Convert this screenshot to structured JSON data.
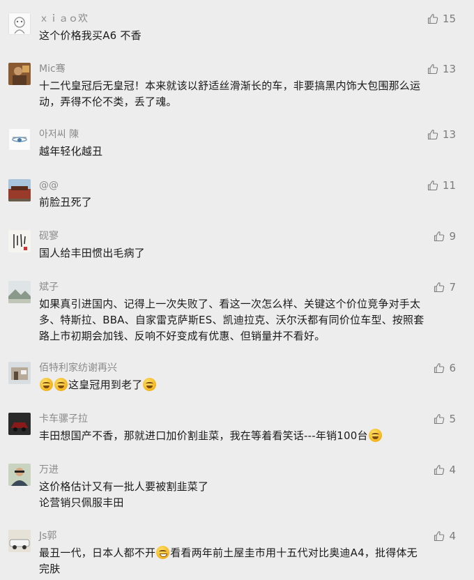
{
  "comments": [
    {
      "nick": "ｘｉａｏ欢",
      "likes": "15",
      "avatar_icon": "robot-avatar-icon",
      "lines": [
        {
          "text": "这个价格我买A6 不香"
        }
      ]
    },
    {
      "nick": "Mic骞",
      "likes": "13",
      "avatar_icon": "photo-avatar-icon",
      "lines": [
        {
          "text": "十二代皇冠后无皇冠！本来就该以舒适丝滑渐长的车，非要搞黑内饰大包围那么运"
        },
        {
          "text": "动，弄得不伦不类，丢了魂。"
        }
      ]
    },
    {
      "nick": "아저씨 陳",
      "likes": "13",
      "avatar_icon": "drone-avatar-icon",
      "lines": [
        {
          "text": "越年轻化越丑"
        }
      ]
    },
    {
      "nick": "@@",
      "likes": "11",
      "avatar_icon": "building-avatar-icon",
      "lines": [
        {
          "text": "前脸丑死了"
        }
      ]
    },
    {
      "nick": "砚寥",
      "likes": "9",
      "avatar_icon": "calligraphy-avatar-icon",
      "lines": [
        {
          "text": "国人给丰田惯出毛病了"
        }
      ]
    },
    {
      "nick": "斌子",
      "likes": "7",
      "avatar_icon": "landscape-avatar-icon",
      "lines": [
        {
          "text": "如果真引进国内、记得上一次失败了、看这一次怎么样、关键这个价位竞争对手太"
        },
        {
          "text": "多、特斯拉、BBA、自家雷克萨斯ES、凯迪拉克、沃尔沃都有同价位车型、按照套"
        },
        {
          "text": "路上市初期会加钱、反响不好变成有优惠、但销量并不看好。"
        }
      ]
    },
    {
      "nick": "佰特利家纺谢再兴",
      "likes": "6",
      "avatar_icon": "shop-avatar-icon",
      "lines": [
        {
          "text": "这皇冠用到老了",
          "emoji_before": 2,
          "emoji_after": 1
        }
      ]
    },
    {
      "nick": "卡车骡子拉",
      "likes": "5",
      "avatar_icon": "car-avatar-icon",
      "lines": [
        {
          "text": "丰田想国产不香，那就进口加价割韭菜，我在等着看笑话---年销100台",
          "emoji_after": 1
        }
      ]
    },
    {
      "nick": "万进",
      "likes": "4",
      "avatar_icon": "person-avatar-icon",
      "lines": [
        {
          "text": "这价格估计又有一批人要被割韭菜了"
        },
        {
          "text": "论营销只佩服丰田"
        }
      ]
    },
    {
      "nick": "Js郭",
      "likes": "4",
      "avatar_icon": "vehicle-avatar-icon",
      "lines": [
        {
          "text": "最丑一代，日本人都不开",
          "inline_emoji": true,
          "text2": "看看两年前土屋圭市用十五代对比奥迪A4，批得体无"
        },
        {
          "text": "完肤"
        }
      ]
    }
  ],
  "colors": {
    "background": "#ededed",
    "nick": "#8a8a8a",
    "content": "#1a1a1a",
    "like": "#7b7b7b"
  }
}
